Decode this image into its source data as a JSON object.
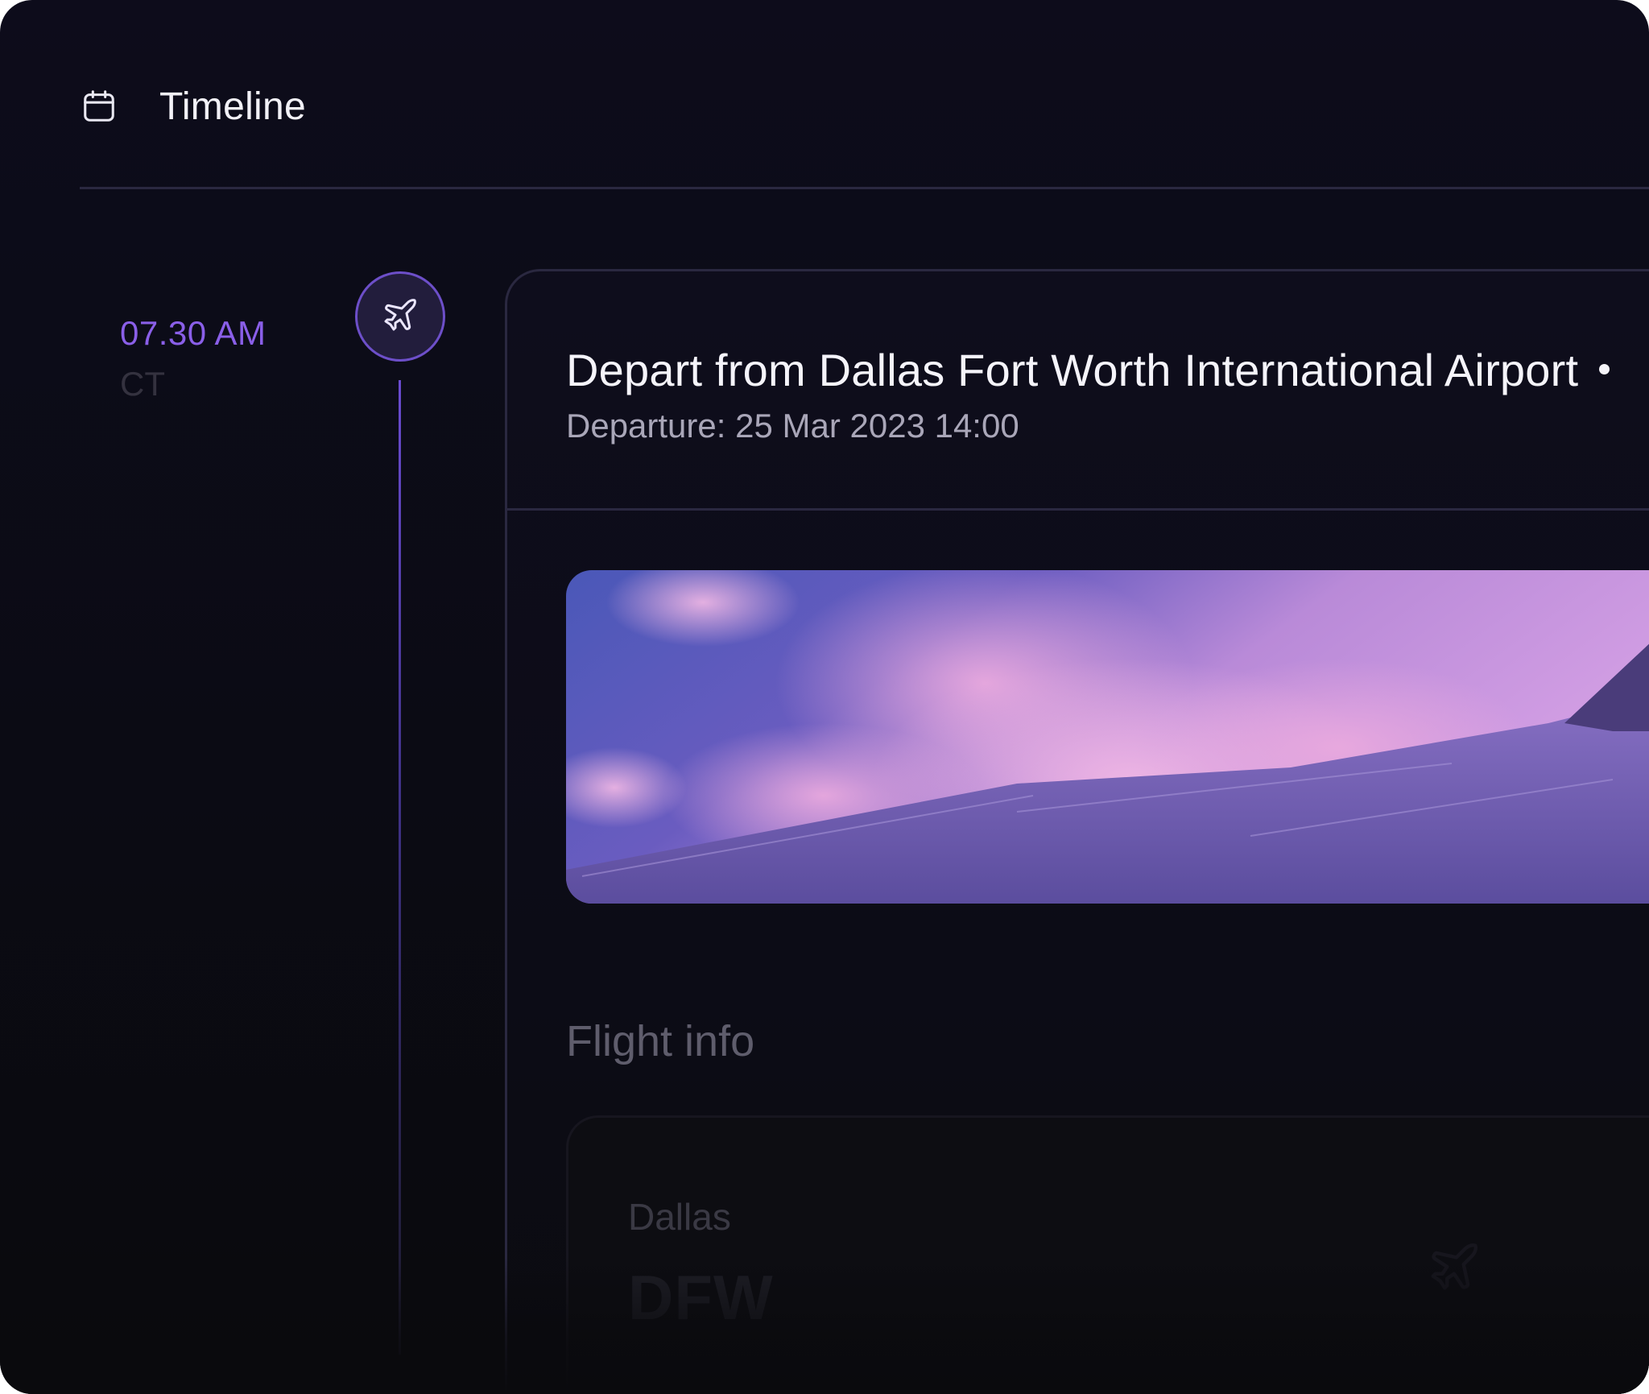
{
  "header": {
    "icon": "calendar-icon",
    "title": "Timeline"
  },
  "timeline": {
    "time": "07.30 AM",
    "timezone": "CT",
    "event_icon": "airplane-icon"
  },
  "event_card": {
    "title": "Depart from Dallas Fort Worth International Airport",
    "subtitle": "Departure: 25 Mar 2023 14:00",
    "image": "airplane-wing-sky-image",
    "section_title": "Flight info",
    "flight_info": {
      "origin_city": "Dallas",
      "origin_code": "DFW"
    }
  },
  "colors": {
    "background": "#0d0c1b",
    "accent": "#8a5fe8",
    "divider": "#2a2840",
    "text_primary": "#f5f4fa",
    "text_secondary": "#a9a6b8"
  }
}
